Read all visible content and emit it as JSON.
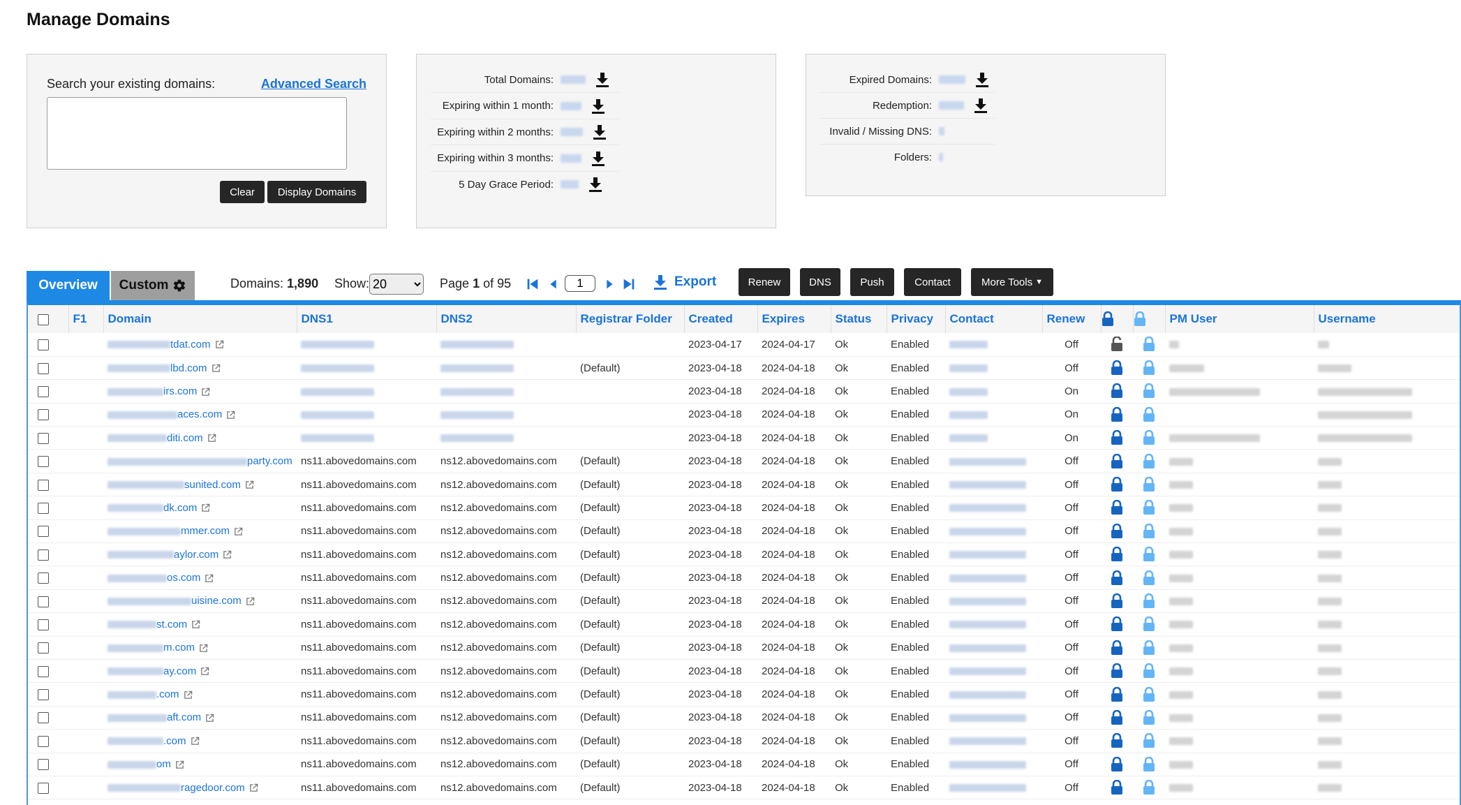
{
  "page": {
    "title": "Manage Domains"
  },
  "search": {
    "label": "Search your existing domains:",
    "advanced_link": "Advanced Search",
    "value": "",
    "clear_label": "Clear",
    "display_label": "Display Domains"
  },
  "stats": [
    {
      "label": "Total Domains:"
    },
    {
      "label": "Expiring within 1 month:"
    },
    {
      "label": "Expiring within 2 months:"
    },
    {
      "label": "Expiring within 3 months:"
    },
    {
      "label": "5 Day Grace Period:"
    }
  ],
  "expired_stats": [
    {
      "label": "Expired Domains:"
    },
    {
      "label": "Redemption:"
    },
    {
      "label": "Invalid / Missing DNS:"
    },
    {
      "label": "Folders:"
    }
  ],
  "tabs": {
    "overview": "Overview",
    "custom": "Custom"
  },
  "toolbar": {
    "domains_label": "Domains:",
    "domains_count": "1,890",
    "show_label": "Show:",
    "show_value": "20",
    "page_prefix": "Page",
    "page_current": "1",
    "page_of": "of 95",
    "page_input": "1",
    "export_label": "Export",
    "buttons": {
      "renew": "Renew",
      "dns": "DNS",
      "push": "Push",
      "contact": "Contact",
      "more_tools": "More Tools"
    }
  },
  "colors": {
    "accent": "#1e88e5",
    "link": "#1a73d9",
    "dark_button": "#262626",
    "lock_dark": "#1565c0",
    "lock_light": "#64b5f6"
  },
  "table": {
    "headers": {
      "f1": "F1",
      "domain": "Domain",
      "dns1": "DNS1",
      "dns2": "DNS2",
      "registrar_folder": "Registrar Folder",
      "created": "Created",
      "expires": "Expires",
      "status": "Status",
      "privacy": "Privacy",
      "contact": "Contact",
      "renew": "Renew",
      "pm_user": "PM User",
      "username": "Username"
    },
    "rows": [
      {
        "domain": "tdat.com",
        "dns1": "",
        "dns2": "",
        "folder": "",
        "created": "2023-04-17",
        "expires": "2024-04-17",
        "status": "Ok",
        "privacy": "Enabled",
        "renew": "Off",
        "lock": "unlocked"
      },
      {
        "domain": "lbd.com",
        "dns1": "",
        "dns2": "",
        "folder": "(Default)",
        "created": "2023-04-18",
        "expires": "2024-04-18",
        "status": "Ok",
        "privacy": "Enabled",
        "renew": "Off",
        "lock": "locked"
      },
      {
        "domain": "irs.com",
        "dns1": "",
        "dns2": "",
        "folder": "",
        "created": "2023-04-18",
        "expires": "2024-04-18",
        "status": "Ok",
        "privacy": "Enabled",
        "renew": "On",
        "lock": "locked"
      },
      {
        "domain": "aces.com",
        "dns1": "",
        "dns2": "",
        "folder": "",
        "created": "2023-04-18",
        "expires": "2024-04-18",
        "status": "Ok",
        "privacy": "Enabled",
        "renew": "On",
        "lock": "locked"
      },
      {
        "domain": "diti.com",
        "dns1": "",
        "dns2": "",
        "folder": "",
        "created": "2023-04-18",
        "expires": "2024-04-18",
        "status": "Ok",
        "privacy": "Enabled",
        "renew": "On",
        "lock": "locked"
      },
      {
        "domain": "party.com",
        "dns1": "ns11.abovedomains.com",
        "dns2": "ns12.abovedomains.com",
        "folder": "(Default)",
        "created": "2023-04-18",
        "expires": "2024-04-18",
        "status": "Ok",
        "privacy": "Enabled",
        "renew": "Off",
        "lock": "locked"
      },
      {
        "domain": "sunited.com",
        "dns1": "ns11.abovedomains.com",
        "dns2": "ns12.abovedomains.com",
        "folder": "(Default)",
        "created": "2023-04-18",
        "expires": "2024-04-18",
        "status": "Ok",
        "privacy": "Enabled",
        "renew": "Off",
        "lock": "locked"
      },
      {
        "domain": "dk.com",
        "dns1": "ns11.abovedomains.com",
        "dns2": "ns12.abovedomains.com",
        "folder": "(Default)",
        "created": "2023-04-18",
        "expires": "2024-04-18",
        "status": "Ok",
        "privacy": "Enabled",
        "renew": "Off",
        "lock": "locked"
      },
      {
        "domain": "mmer.com",
        "dns1": "ns11.abovedomains.com",
        "dns2": "ns12.abovedomains.com",
        "folder": "(Default)",
        "created": "2023-04-18",
        "expires": "2024-04-18",
        "status": "Ok",
        "privacy": "Enabled",
        "renew": "Off",
        "lock": "locked"
      },
      {
        "domain": "aylor.com",
        "dns1": "ns11.abovedomains.com",
        "dns2": "ns12.abovedomains.com",
        "folder": "(Default)",
        "created": "2023-04-18",
        "expires": "2024-04-18",
        "status": "Ok",
        "privacy": "Enabled",
        "renew": "Off",
        "lock": "locked"
      },
      {
        "domain": "os.com",
        "dns1": "ns11.abovedomains.com",
        "dns2": "ns12.abovedomains.com",
        "folder": "(Default)",
        "created": "2023-04-18",
        "expires": "2024-04-18",
        "status": "Ok",
        "privacy": "Enabled",
        "renew": "Off",
        "lock": "locked"
      },
      {
        "domain": "uisine.com",
        "dns1": "ns11.abovedomains.com",
        "dns2": "ns12.abovedomains.com",
        "folder": "(Default)",
        "created": "2023-04-18",
        "expires": "2024-04-18",
        "status": "Ok",
        "privacy": "Enabled",
        "renew": "Off",
        "lock": "locked"
      },
      {
        "domain": "st.com",
        "dns1": "ns11.abovedomains.com",
        "dns2": "ns12.abovedomains.com",
        "folder": "(Default)",
        "created": "2023-04-18",
        "expires": "2024-04-18",
        "status": "Ok",
        "privacy": "Enabled",
        "renew": "Off",
        "lock": "locked"
      },
      {
        "domain": "m.com",
        "dns1": "ns11.abovedomains.com",
        "dns2": "ns12.abovedomains.com",
        "folder": "(Default)",
        "created": "2023-04-18",
        "expires": "2024-04-18",
        "status": "Ok",
        "privacy": "Enabled",
        "renew": "Off",
        "lock": "locked"
      },
      {
        "domain": "ay.com",
        "dns1": "ns11.abovedomains.com",
        "dns2": "ns12.abovedomains.com",
        "folder": "(Default)",
        "created": "2023-04-18",
        "expires": "2024-04-18",
        "status": "Ok",
        "privacy": "Enabled",
        "renew": "Off",
        "lock": "locked"
      },
      {
        "domain": ".com",
        "dns1": "ns11.abovedomains.com",
        "dns2": "ns12.abovedomains.com",
        "folder": "(Default)",
        "created": "2023-04-18",
        "expires": "2024-04-18",
        "status": "Ok",
        "privacy": "Enabled",
        "renew": "Off",
        "lock": "locked"
      },
      {
        "domain": "aft.com",
        "dns1": "ns11.abovedomains.com",
        "dns2": "ns12.abovedomains.com",
        "folder": "(Default)",
        "created": "2023-04-18",
        "expires": "2024-04-18",
        "status": "Ok",
        "privacy": "Enabled",
        "renew": "Off",
        "lock": "locked"
      },
      {
        "domain": ".com",
        "dns1": "ns11.abovedomains.com",
        "dns2": "ns12.abovedomains.com",
        "folder": "(Default)",
        "created": "2023-04-18",
        "expires": "2024-04-18",
        "status": "Ok",
        "privacy": "Enabled",
        "renew": "Off",
        "lock": "locked"
      },
      {
        "domain": "om",
        "dns1": "ns11.abovedomains.com",
        "dns2": "ns12.abovedomains.com",
        "folder": "(Default)",
        "created": "2023-04-18",
        "expires": "2024-04-18",
        "status": "Ok",
        "privacy": "Enabled",
        "renew": "Off",
        "lock": "locked"
      },
      {
        "domain": "ragedoor.com",
        "dns1": "ns11.abovedomains.com",
        "dns2": "ns12.abovedomains.com",
        "folder": "(Default)",
        "created": "2023-04-18",
        "expires": "2024-04-18",
        "status": "Ok",
        "privacy": "Enabled",
        "renew": "Off",
        "lock": "locked"
      }
    ]
  }
}
